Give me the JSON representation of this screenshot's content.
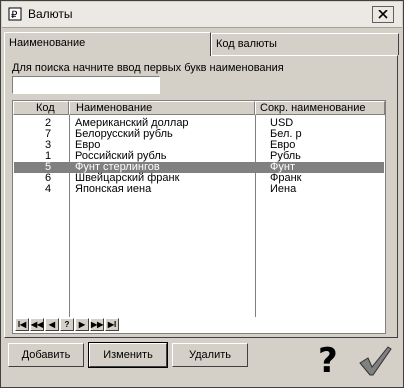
{
  "window": {
    "title": "Валюты"
  },
  "tabs": [
    {
      "label": "Наименование"
    },
    {
      "label": "Код валюты"
    }
  ],
  "search": {
    "hint": "Для поиска начните ввод первых букв наименования",
    "value": ""
  },
  "table": {
    "columns": [
      "Код",
      "Наименование",
      "Сокр. наименование"
    ],
    "rows": [
      {
        "code": "2",
        "name": "Американский доллар",
        "short": "USD",
        "selected": false
      },
      {
        "code": "7",
        "name": "Белорусский рубль",
        "short": "Бел. р",
        "selected": false
      },
      {
        "code": "3",
        "name": "Евро",
        "short": "Евро",
        "selected": false
      },
      {
        "code": "1",
        "name": "Российский рубль",
        "short": "Рубль",
        "selected": false
      },
      {
        "code": "5",
        "name": "Фунт стерлингов",
        "short": "Фунт",
        "selected": true
      },
      {
        "code": "6",
        "name": "Швейцарский франк",
        "short": "Франк",
        "selected": false
      },
      {
        "code": "4",
        "name": "Японская иена",
        "short": "Иена",
        "selected": false
      }
    ]
  },
  "navigator": [
    "I◀",
    "◀◀",
    "◀",
    "?",
    "▶",
    "▶▶",
    "▶I"
  ],
  "buttons": {
    "add": "Добавить",
    "edit": "Изменить",
    "delete": "Удалить",
    "help": "?"
  },
  "icons": {
    "app": "currency-app-icon",
    "close": "close-icon",
    "help": "question-mark-icon",
    "ok": "checkmark-icon"
  }
}
